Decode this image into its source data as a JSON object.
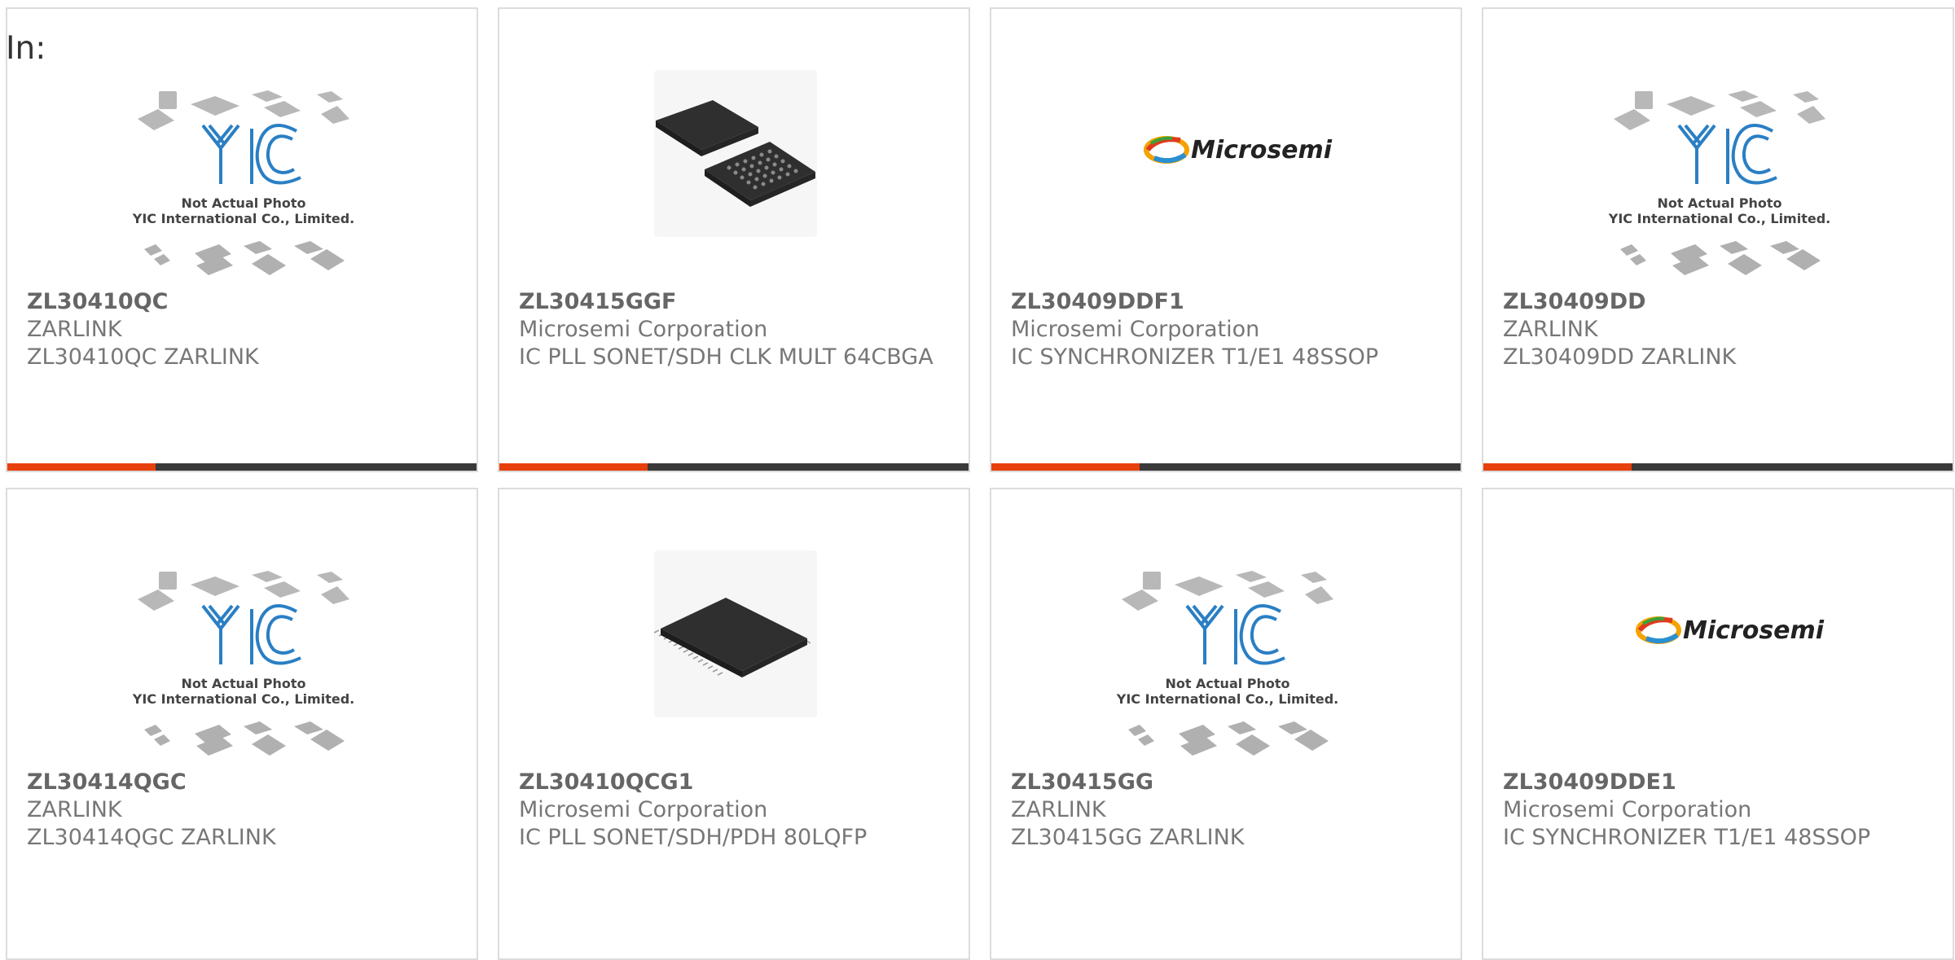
{
  "header": {
    "label": "In:"
  },
  "colors": {
    "accent": "#e8400c",
    "bar": "#3a3a3a",
    "yic_blue": "#2a7fc4",
    "border": "#dcdcdc"
  },
  "products": [
    {
      "part": "ZL30410QC",
      "manufacturer": "ZARLINK",
      "description": "ZL30410QC ZARLINK",
      "image": "yic-placeholder",
      "placeholder_caption": "Not Actual Photo",
      "placeholder_company": "YIC International Co., Limited."
    },
    {
      "part": "ZL30415GGF",
      "manufacturer": "Microsemi Corporation",
      "description": "IC PLL SONET/SDH CLK MULT 64CBGA",
      "image": "bga-chip"
    },
    {
      "part": "ZL30409DDF1",
      "manufacturer": "Microsemi Corporation",
      "description": "IC SYNCHRONIZER T1/E1 48SSOP",
      "image": "microsemi-logo",
      "logo_text": "Microsemi"
    },
    {
      "part": "ZL30409DD",
      "manufacturer": "ZARLINK",
      "description": "ZL30409DD ZARLINK",
      "image": "yic-placeholder",
      "placeholder_caption": "Not Actual Photo",
      "placeholder_company": "YIC International Co., Limited."
    },
    {
      "part": "ZL30414QGC",
      "manufacturer": "ZARLINK",
      "description": "ZL30414QGC ZARLINK",
      "image": "yic-placeholder",
      "placeholder_caption": "Not Actual Photo",
      "placeholder_company": "YIC International Co., Limited."
    },
    {
      "part": "ZL30410QCG1",
      "manufacturer": "Microsemi Corporation",
      "description": "IC PLL SONET/SDH/PDH 80LQFP",
      "image": "lqfp-chip"
    },
    {
      "part": "ZL30415GG",
      "manufacturer": "ZARLINK",
      "description": "ZL30415GG ZARLINK",
      "image": "yic-placeholder",
      "placeholder_caption": "Not Actual Photo",
      "placeholder_company": "YIC International Co., Limited."
    },
    {
      "part": "ZL30409DDE1",
      "manufacturer": "Microsemi Corporation",
      "description": "IC SYNCHRONIZER T1/E1 48SSOP",
      "image": "microsemi-logo",
      "logo_text": "Microsemi"
    }
  ]
}
